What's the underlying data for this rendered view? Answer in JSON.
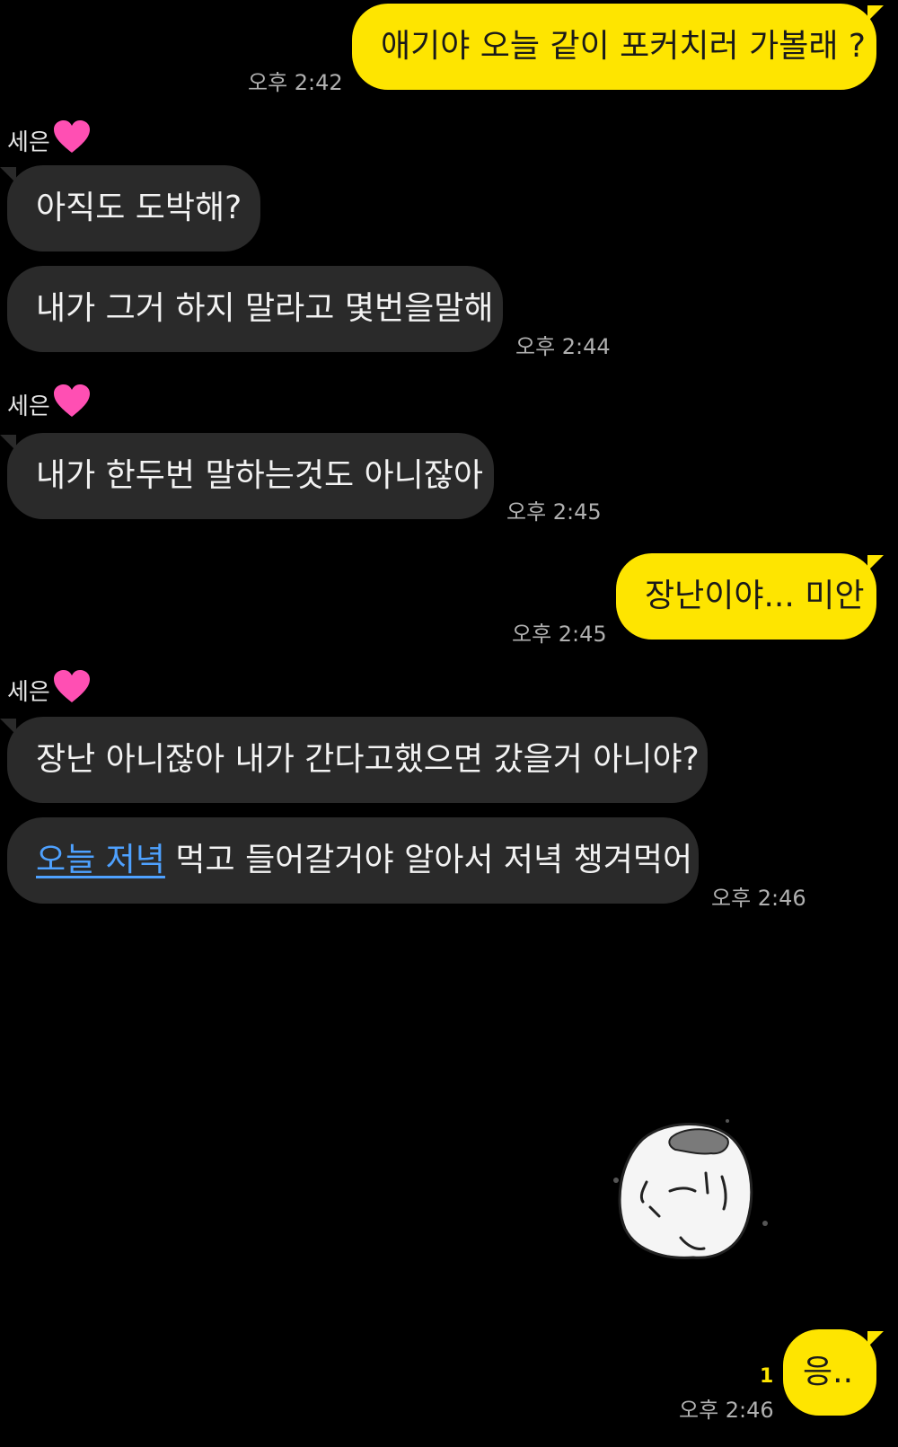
{
  "messages": [
    {
      "text": "애기야 오늘 같이 포커치러 가볼래 ?",
      "time": "오후 2:42"
    },
    {
      "sender": "세은",
      "text": "아직도 도박해?"
    },
    {
      "text": "내가 그거 하지 말라고 몇번을말해",
      "time": "오후 2:44"
    },
    {
      "sender": "세은",
      "text": "내가 한두번 말하는것도 아니잖아",
      "time": "오후 2:45"
    },
    {
      "text": "장난이야... 미안",
      "time": "오후 2:45"
    },
    {
      "sender": "세은",
      "text": "장난 아니잖아 내가 간다고했으면 갔을거 아니야?"
    },
    {
      "link_text": "오늘 저녁",
      "rest_text": " 먹고 들어갈거야 알아서 저녁 챙겨먹어",
      "time": "오후 2:46"
    },
    {
      "text": "응..",
      "time": "오후 2:46",
      "unread": "1"
    }
  ],
  "sender_heart": "💗",
  "colors": {
    "background": "#000000",
    "my_bubble": "#fee500",
    "their_bubble": "#2a2a2a",
    "link": "#4ea1ff",
    "unread": "#fee500"
  },
  "icons": {
    "heart": "pink-heart-emoji",
    "sticker": "sad-rice-ball-sticker"
  }
}
